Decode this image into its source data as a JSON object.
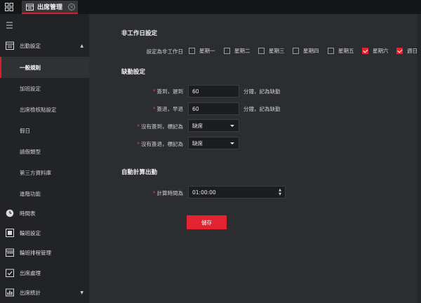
{
  "topbar": {
    "tab_label": "出席管理",
    "close_glyph": "×"
  },
  "sidebar": {
    "attendance_settings": {
      "label": "出勤設定",
      "icon": "calendar-icon"
    },
    "sub_items": [
      {
        "label": "一般規則",
        "active": true
      },
      {
        "label": "加班設定"
      },
      {
        "label": "出席檢核點設定"
      },
      {
        "label": "假日"
      },
      {
        "label": "請假類型"
      },
      {
        "label": "第三方資料庫"
      },
      {
        "label": "進階功能"
      }
    ],
    "items": [
      {
        "label": "時間表",
        "icon": "clock-icon"
      },
      {
        "label": "輪班設定",
        "icon": "shift-icon"
      },
      {
        "label": "輪班排程管理",
        "icon": "schedule-icon"
      },
      {
        "label": "出席處理",
        "icon": "process-icon"
      },
      {
        "label": "出席統計",
        "icon": "stats-icon"
      }
    ]
  },
  "main": {
    "nonwork": {
      "title": "非工作日設定",
      "label": "設定為非工作日",
      "days": [
        {
          "label": "星期一",
          "checked": false
        },
        {
          "label": "星期二",
          "checked": false
        },
        {
          "label": "星期三",
          "checked": false
        },
        {
          "label": "星期四",
          "checked": false
        },
        {
          "label": "星期五",
          "checked": false
        },
        {
          "label": "星期六",
          "checked": true
        },
        {
          "label": "週日",
          "checked": true
        }
      ]
    },
    "absence": {
      "title": "缺勤設定",
      "late_label": "簽到，遲到",
      "late_value": "60",
      "late_unit": "分鐘，記為缺勤",
      "early_label": "簽退，早退",
      "early_value": "60",
      "early_unit": "分鐘，記為缺勤",
      "no_checkin_label": "沒有簽到，標記為",
      "no_checkin_value": "缺席",
      "no_checkout_label": "沒有簽退，標記為",
      "no_checkout_value": "缺席"
    },
    "auto": {
      "title": "自動計算出勤",
      "time_label": "計算時間為",
      "time_value": "01:00:00"
    },
    "save_label": "儲存"
  }
}
